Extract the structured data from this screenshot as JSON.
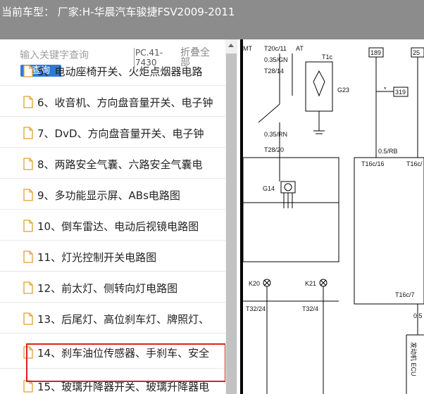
{
  "header": {
    "title": "当前车型： 厂家:H-华晨汽车骏捷FSV2009-2011"
  },
  "search": {
    "placeholder": "输入关键字查询",
    "button_label": "查询",
    "code": "PC.41-7430",
    "fold_all_label": "折叠全部"
  },
  "list": {
    "items": [
      {
        "label": "5、电动座椅开关、火炬点烟器电路"
      },
      {
        "label": "6、收音机、方向盘音量开关、电子钟"
      },
      {
        "label": "7、DvD、方向盘音量开关、电子钟"
      },
      {
        "label": "8、两路安全气囊、六路安全气囊电"
      },
      {
        "label": "9、多功能显示屏、ABs电路图"
      },
      {
        "label": "10、倒车雷达、电动后视镜电路图"
      },
      {
        "label": "11、灯光控制开关电路图"
      },
      {
        "label": "12、前太灯、侧转向灯电路图"
      },
      {
        "label": "13、后尾灯、高位刹车灯、牌照灯、"
      },
      {
        "label": "14、刹车油位传感器、手刹车、安全"
      },
      {
        "label": "15、玻璃升降器开关、玻璃升降器电"
      }
    ]
  },
  "diagram": {
    "labels": {
      "mt": "MT",
      "t20c11": "T20c/11",
      "at": "AT",
      "gn": "0.35/GN",
      "t28_14": "T28/14",
      "t1c": "T1c",
      "g23": "G23",
      "rn": "0.35/RN",
      "t28_20": "T28/20",
      "n189": "189",
      "n25": "25",
      "n319": "319",
      "star": "*",
      "rb": "0.5/RB",
      "t16c16": "T16c/16",
      "t16c": "T16c/",
      "g14": "G14",
      "k20": "K20",
      "k21": "K21",
      "t16c7": "T16c/7",
      "t32_24": "T32/24",
      "t32_4": "T32/4",
      "p05": "0.5",
      "ecu": "发动机 ECU"
    }
  },
  "colors": {
    "header_bg": "#8c8c8c",
    "button_bg": "#2e7bd6",
    "highlight": "#e02020"
  }
}
